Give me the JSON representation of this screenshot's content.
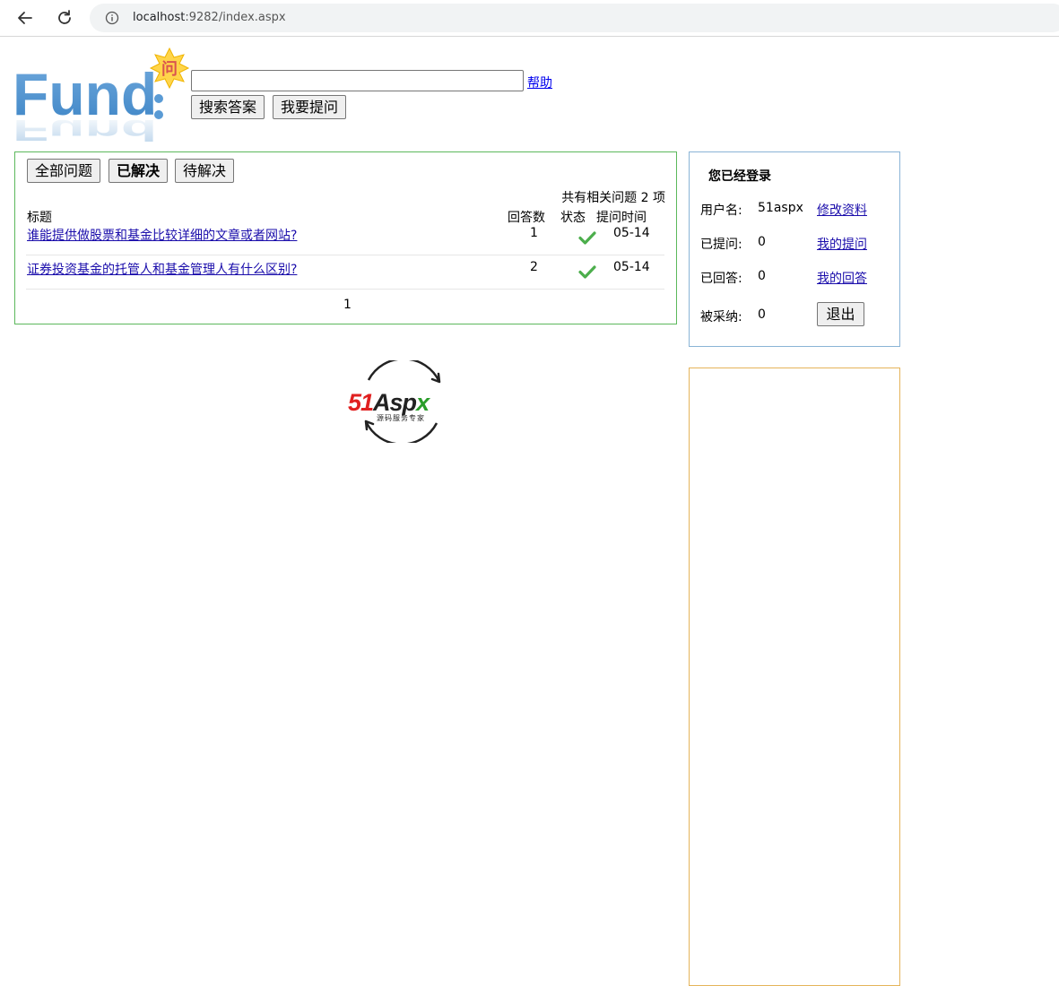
{
  "browser": {
    "url_host": "localhost",
    "url_rest": ":9282/index.aspx"
  },
  "header": {
    "logo_text": "Fund",
    "logo_badge": "问",
    "search_value": "",
    "help_label": "帮助",
    "search_button": "搜索答案",
    "ask_button": "我要提问"
  },
  "tabs": [
    {
      "label": "全部问题",
      "active": false
    },
    {
      "label": "已解决",
      "active": true
    },
    {
      "label": "待解决",
      "active": false
    }
  ],
  "list": {
    "count_text": "共有相关问题 2 项",
    "columns": {
      "title": "标题",
      "answers": "回答数",
      "status": "状态",
      "time": "提问时间"
    },
    "rows": [
      {
        "title": "谁能提供做股票和基金比较详细的文章或者网站?",
        "answers": "1",
        "status": "solved",
        "time": "05-14"
      },
      {
        "title": "证券投资基金的托管人和基金管理人有什么区别?",
        "answers": "2",
        "status": "solved",
        "time": "05-14"
      }
    ],
    "pager": "1"
  },
  "login": {
    "title": "您已经登录",
    "username_label": "用户名:",
    "username_value": "51aspx",
    "edit_link": "修改资料",
    "asked_label": "已提问:",
    "asked_value": "0",
    "my_questions_link": "我的提问",
    "answered_label": "已回答:",
    "answered_value": "0",
    "my_answers_link": "我的回答",
    "adopted_label": "被采纳:",
    "adopted_value": "0",
    "logout_button": "退出"
  },
  "footer_logo": {
    "brand_red": "51",
    "brand_dark": "Asp",
    "brand_green": "x",
    "tagline": "源码服务专家"
  },
  "colors": {
    "panel_border": "#5cb85c",
    "login_border": "#8ab4d6",
    "ad_border": "#e5b45a",
    "check": "#4cae4c",
    "link": "#1a0dab"
  }
}
